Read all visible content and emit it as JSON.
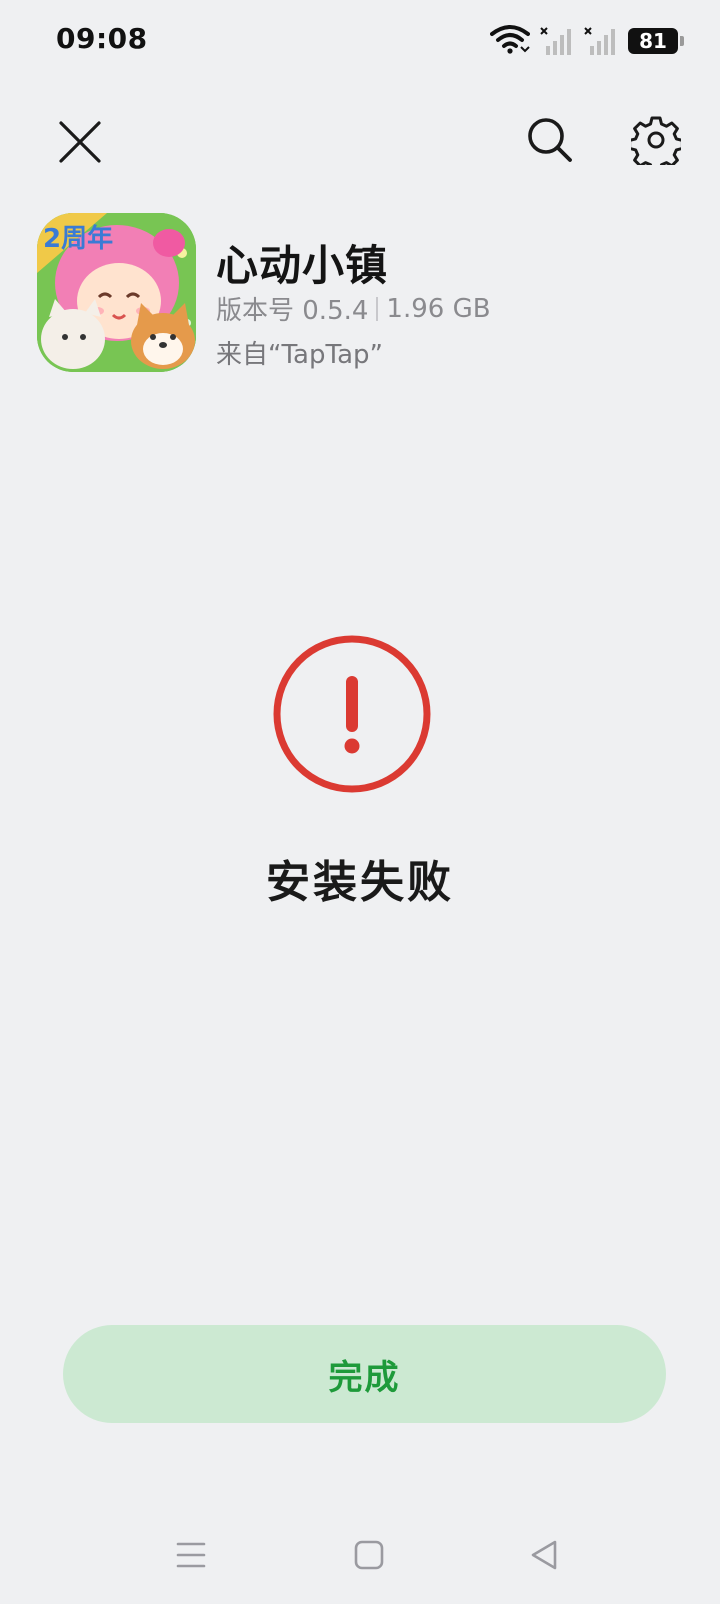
{
  "status_bar": {
    "time": "09:08",
    "battery": "81",
    "icons": [
      "wifi-icon",
      "signal-no-service-icon",
      "signal-no-service-icon",
      "battery-icon"
    ]
  },
  "toolbar": {
    "icons": [
      "close-icon",
      "search-icon",
      "gear-icon"
    ]
  },
  "app": {
    "name": "心动小镇",
    "version_label": "版本号 0.5.4",
    "size": "1.96 GB",
    "source": "来自“TapTap”",
    "icon_badge": "2周年"
  },
  "result": {
    "title": "安装失败",
    "icon": "error-circle-icon",
    "color": "#db3a32"
  },
  "actions": {
    "done_label": "完成",
    "done_bg": "#cce9d2",
    "done_color": "#1e9a3a"
  },
  "nav_bar": {
    "icons": [
      "menu-icon",
      "home-icon",
      "back-icon"
    ]
  }
}
